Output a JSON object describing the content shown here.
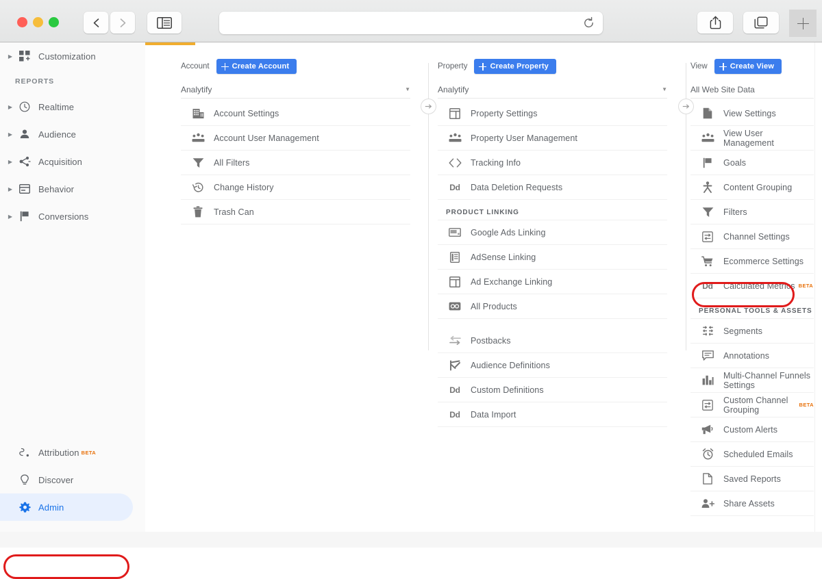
{
  "browser": {
    "url_value": "",
    "url_placeholder": "",
    "back_label": "‹",
    "forward_label": "›"
  },
  "sidebar": {
    "top_items": [
      {
        "label": "Customization",
        "icon": "customization-icon",
        "expandable": true
      }
    ],
    "reports_section_title": "REPORTS",
    "report_items": [
      {
        "label": "Realtime",
        "icon": "clock-icon",
        "expandable": true
      },
      {
        "label": "Audience",
        "icon": "person-icon",
        "expandable": true
      },
      {
        "label": "Acquisition",
        "icon": "acquisition-icon",
        "expandable": true
      },
      {
        "label": "Behavior",
        "icon": "behavior-icon",
        "expandable": true
      },
      {
        "label": "Conversions",
        "icon": "flag-icon",
        "expandable": true
      }
    ],
    "bottom_items": [
      {
        "label": "Attribution",
        "icon": "attribution-icon",
        "badge": "BETA",
        "active": false
      },
      {
        "label": "Discover",
        "icon": "bulb-icon",
        "badge": "",
        "active": false
      },
      {
        "label": "Admin",
        "icon": "gear-icon",
        "badge": "",
        "active": true
      }
    ]
  },
  "account_column": {
    "header_label": "Account",
    "create_button": "Create Account",
    "selected": "Analytify",
    "items": [
      {
        "label": "Account Settings",
        "icon": "building-icon"
      },
      {
        "label": "Account User Management",
        "icon": "users-icon"
      },
      {
        "label": "All Filters",
        "icon": "funnel-icon"
      },
      {
        "label": "Change History",
        "icon": "history-icon"
      },
      {
        "label": "Trash Can",
        "icon": "trash-icon"
      }
    ]
  },
  "property_column": {
    "header_label": "Property",
    "create_button": "Create Property",
    "selected": "Analytify",
    "items": [
      {
        "label": "Property Settings",
        "icon": "window-icon"
      },
      {
        "label": "Property User Management",
        "icon": "users-icon"
      },
      {
        "label": "Tracking Info",
        "icon": "code-icon"
      },
      {
        "label": "Data Deletion Requests",
        "icon": "dd-icon"
      }
    ],
    "group_title": "PRODUCT LINKING",
    "linking_items": [
      {
        "label": "Google Ads Linking",
        "icon": "ads-icon"
      },
      {
        "label": "AdSense Linking",
        "icon": "adsense-icon"
      },
      {
        "label": "Ad Exchange Linking",
        "icon": "window-icon"
      },
      {
        "label": "All Products",
        "icon": "allproducts-icon"
      }
    ],
    "extra_items": [
      {
        "label": "Postbacks",
        "icon": "postbacks-icon"
      },
      {
        "label": "Audience Definitions",
        "icon": "audience-def-icon"
      },
      {
        "label": "Custom Definitions",
        "icon": "dd-icon"
      },
      {
        "label": "Data Import",
        "icon": "dd-icon"
      }
    ]
  },
  "view_column": {
    "header_label": "View",
    "create_button": "Create View",
    "selected": "All Web Site Data",
    "items": [
      {
        "label": "View Settings",
        "icon": "document-icon",
        "badge": ""
      },
      {
        "label": "View User Management",
        "icon": "users-icon",
        "badge": ""
      },
      {
        "label": "Goals",
        "icon": "flag-icon",
        "badge": ""
      },
      {
        "label": "Content Grouping",
        "icon": "grouping-icon",
        "badge": ""
      },
      {
        "label": "Filters",
        "icon": "funnel-icon",
        "badge": ""
      },
      {
        "label": "Channel Settings",
        "icon": "channel-icon",
        "badge": ""
      },
      {
        "label": "Ecommerce Settings",
        "icon": "cart-icon",
        "badge": "",
        "highlighted": true
      },
      {
        "label": "Calculated Metrics",
        "icon": "dd-icon",
        "badge": "BETA"
      }
    ],
    "group_title": "PERSONAL TOOLS & ASSETS",
    "tool_items": [
      {
        "label": "Multi-Channel Funnels Settings",
        "icon": "bars-icon",
        "badge": ""
      },
      {
        "label": "Segments",
        "icon": "segments-icon",
        "badge": ""
      },
      {
        "label": "Annotations",
        "icon": "comment-icon",
        "badge": ""
      },
      {
        "label": "Custom Channel Grouping",
        "icon": "channel-icon",
        "badge": "BETA"
      },
      {
        "label": "Custom Alerts",
        "icon": "megaphone-icon",
        "badge": ""
      },
      {
        "label": "Scheduled Emails",
        "icon": "alarm-icon",
        "badge": ""
      },
      {
        "label": "Saved Reports",
        "icon": "document-icon",
        "badge": ""
      },
      {
        "label": "Share Assets",
        "icon": "share-user-icon",
        "badge": ""
      }
    ],
    "tool_items_order": [
      "Segments",
      "Annotations",
      "Multi-Channel Funnels Settings",
      "Custom Channel Grouping",
      "Custom Alerts",
      "Scheduled Emails",
      "Saved Reports",
      "Share Assets"
    ]
  },
  "colors": {
    "accent_blue": "#3b7ded",
    "highlight_red": "#e01b1b",
    "tab_orange": "#f0ad2e",
    "beta_orange": "#e8710a",
    "admin_blue": "#1a73e8"
  }
}
